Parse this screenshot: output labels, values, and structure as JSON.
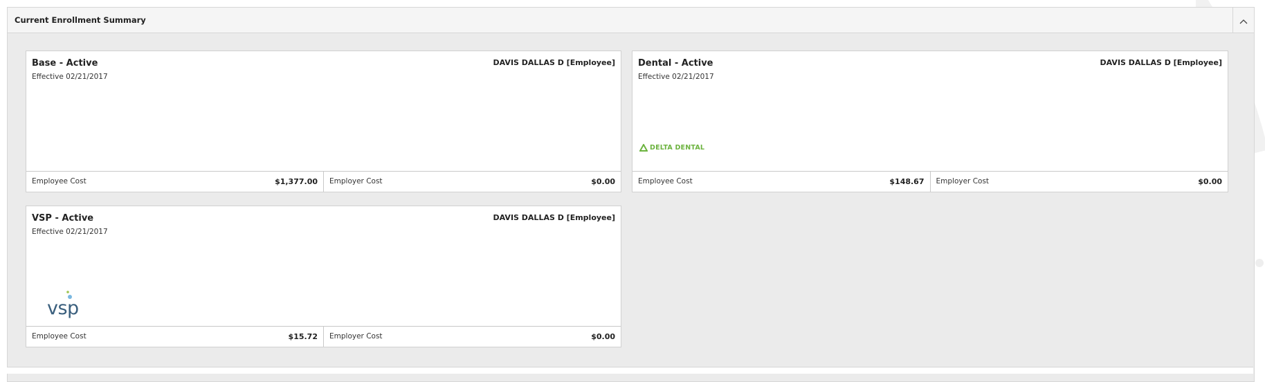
{
  "panel": {
    "title": "Current Enrollment Summary",
    "collapse_icon": "chevron-up-icon"
  },
  "cards": [
    {
      "plan": "Base - Active",
      "effective": "Effective 02/21/2017",
      "member": "DAVIS DALLAS D [Employee]",
      "employee_cost_label": "Employee Cost",
      "employee_cost": "$1,377.00",
      "employer_cost_label": "Employer Cost",
      "employer_cost": "$0.00"
    },
    {
      "plan": "Dental - Active",
      "effective": "Effective 02/21/2017",
      "member": "DAVIS DALLAS D [Employee]",
      "logo_text": "DELTA DENTAL",
      "employee_cost_label": "Employee Cost",
      "employee_cost": "$148.67",
      "employer_cost_label": "Employer Cost",
      "employer_cost": "$0.00"
    },
    {
      "plan": "VSP - Active",
      "effective": "Effective 02/21/2017",
      "member": "DAVIS DALLAS D [Employee]",
      "logo_text": "vsp",
      "employee_cost_label": "Employee Cost",
      "employee_cost": "$15.72",
      "employer_cost_label": "Employer Cost",
      "employer_cost": "$0.00"
    }
  ],
  "colors": {
    "delta_dental_green": "#6cb33f",
    "vsp_blue": "#3a5f7d",
    "vsp_dot_blue": "#7ab8e0",
    "vsp_dot_green": "#9ec54f"
  }
}
